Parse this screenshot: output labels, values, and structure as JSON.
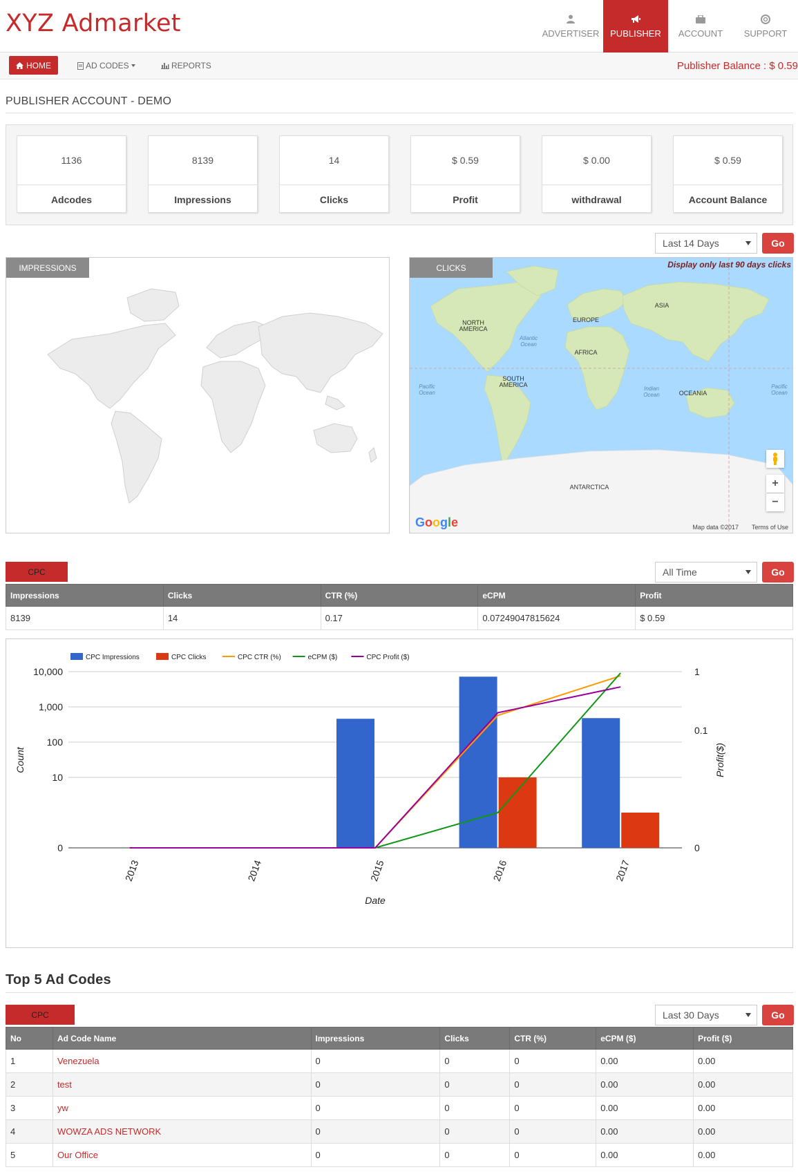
{
  "brand": "XYZ Admarket",
  "topnav": [
    {
      "label": "ADVERTISER",
      "icon": "user-icon",
      "active": false
    },
    {
      "label": "PUBLISHER",
      "icon": "megaphone-icon",
      "active": true
    },
    {
      "label": "ACCOUNT",
      "icon": "briefcase-icon",
      "active": false
    },
    {
      "label": "SUPPORT",
      "icon": "lifebuoy-icon",
      "active": false
    }
  ],
  "subnav": {
    "home": "HOME",
    "adcodes": "AD CODES",
    "reports": "REPORTS",
    "balance": "Publisher Balance : $ 0.59"
  },
  "page_heading": "PUBLISHER ACCOUNT - DEMO",
  "stats": [
    {
      "value": "1136",
      "label": "Adcodes"
    },
    {
      "value": "8139",
      "label": "Impressions"
    },
    {
      "value": "14",
      "label": "Clicks"
    },
    {
      "value": "$ 0.59",
      "label": "Profit"
    },
    {
      "value": "$ 0.00",
      "label": "withdrawal"
    },
    {
      "value": "$ 0.59",
      "label": "Account Balance"
    }
  ],
  "map_range": {
    "selected": "Last 14 Days",
    "go": "Go"
  },
  "impressions_panel": {
    "tab": "IMPRESSIONS"
  },
  "clicks_panel": {
    "tab": "CLICKS",
    "note": "Display only last 90 days clicks",
    "labels": {
      "north_america": "NORTH AMERICA",
      "south_america": "SOUTH AMERICA",
      "europe": "EUROPE",
      "asia": "ASIA",
      "africa": "AFRICA",
      "oceania": "OCEANIA",
      "antarctica": "ANTARCTICA",
      "atlantic": "Atlantic Ocean",
      "pacific_l": "Pacific Ocean",
      "pacific_r": "Pacific Ocean",
      "indian": "Indian Ocean"
    },
    "google": "Google",
    "map_data": "Map data ©2017",
    "terms": "Terms of Use",
    "zoom_in": "+",
    "zoom_out": "−"
  },
  "cpc": {
    "tab": "CPC",
    "range": "All Time",
    "go": "Go",
    "headers": [
      "Impressions",
      "Clicks",
      "CTR (%)",
      "eCPM",
      "Profit"
    ],
    "row": [
      "8139",
      "14",
      "0.17",
      "0.07249047815624",
      "$ 0.59"
    ]
  },
  "chart_data": {
    "type": "bar",
    "title": "",
    "xlabel": "Date",
    "ylabel": "Count",
    "y2label": "Profit($)",
    "categories": [
      "2013",
      "2014",
      "2015",
      "2016",
      "2017"
    ],
    "y_ticks": [
      "10,000",
      "1,000",
      "100",
      "10",
      "0"
    ],
    "y2_ticks": [
      "1",
      "0.1",
      "0"
    ],
    "legend_position": "top-left",
    "series": [
      {
        "name": "CPC Impressions",
        "kind": "bar",
        "axis": "left",
        "color": "#3366cc",
        "values": [
          0,
          0,
          460,
          7200,
          480
        ]
      },
      {
        "name": "CPC Clicks",
        "kind": "bar",
        "axis": "left",
        "color": "#dc3912",
        "values": [
          0,
          0,
          0,
          10,
          5
        ]
      },
      {
        "name": "CPC CTR (%)",
        "kind": "line",
        "axis": "right",
        "color": "#ff9900",
        "values": [
          0,
          0,
          0,
          0.18,
          0.85
        ]
      },
      {
        "name": "eCPM ($)",
        "kind": "line",
        "axis": "right",
        "color": "#109618",
        "values": [
          0,
          0,
          0,
          0.03,
          0.95
        ]
      },
      {
        "name": "CPC Profit ($)",
        "kind": "line",
        "axis": "right",
        "color": "#990099",
        "values": [
          0,
          0,
          0,
          0.2,
          0.55
        ]
      }
    ]
  },
  "top5": {
    "title": "Top 5 Ad Codes",
    "tab": "CPC",
    "range": "Last 30 Days",
    "go": "Go",
    "headers": [
      "No",
      "Ad Code Name",
      "Impressions",
      "Clicks",
      "CTR (%)",
      "eCPM ($)",
      "Profit ($)"
    ],
    "rows": [
      [
        "1",
        "Venezuela",
        "0",
        "0",
        "0",
        "0.00",
        "0.00"
      ],
      [
        "2",
        "test",
        "0",
        "0",
        "0",
        "0.00",
        "0.00"
      ],
      [
        "3",
        "yw",
        "0",
        "0",
        "0",
        "0.00",
        "0.00"
      ],
      [
        "4",
        "WOWZA ADS NETWORK",
        "0",
        "0",
        "0",
        "0.00",
        "0.00"
      ],
      [
        "5",
        "Our Office",
        "0",
        "0",
        "0",
        "0.00",
        "0.00"
      ]
    ]
  }
}
